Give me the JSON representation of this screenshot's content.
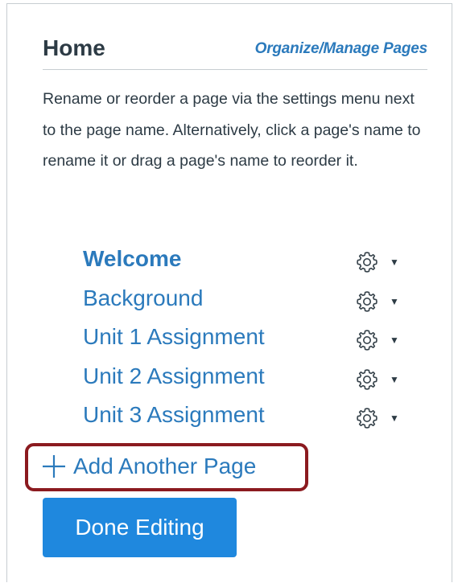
{
  "sidebar": {
    "title": "Home",
    "organize_link": "Organize/Manage Pages",
    "instructions": "Rename or reorder a page via the settings menu next to the page name. Alternatively, click a page's name to rename it or drag a page's name to reorder it.",
    "pages": [
      {
        "label": "Welcome",
        "current": true
      },
      {
        "label": "Background",
        "current": false
      },
      {
        "label": "Unit 1 Assignment",
        "current": false
      },
      {
        "label": "Unit 2 Assignment",
        "current": false
      },
      {
        "label": "Unit 3 Assignment",
        "current": false
      }
    ],
    "settings_icon": "gear-icon",
    "dropdown_icon": "caret-down-icon",
    "add_page_label": "Add Another Page",
    "add_icon": "plus-icon",
    "done_button": "Done Editing"
  },
  "colors": {
    "link": "#2b7abc",
    "text": "#2d3b45",
    "button": "#1f88de",
    "highlight": "#8b1a1f",
    "border": "#c7cdd1"
  }
}
